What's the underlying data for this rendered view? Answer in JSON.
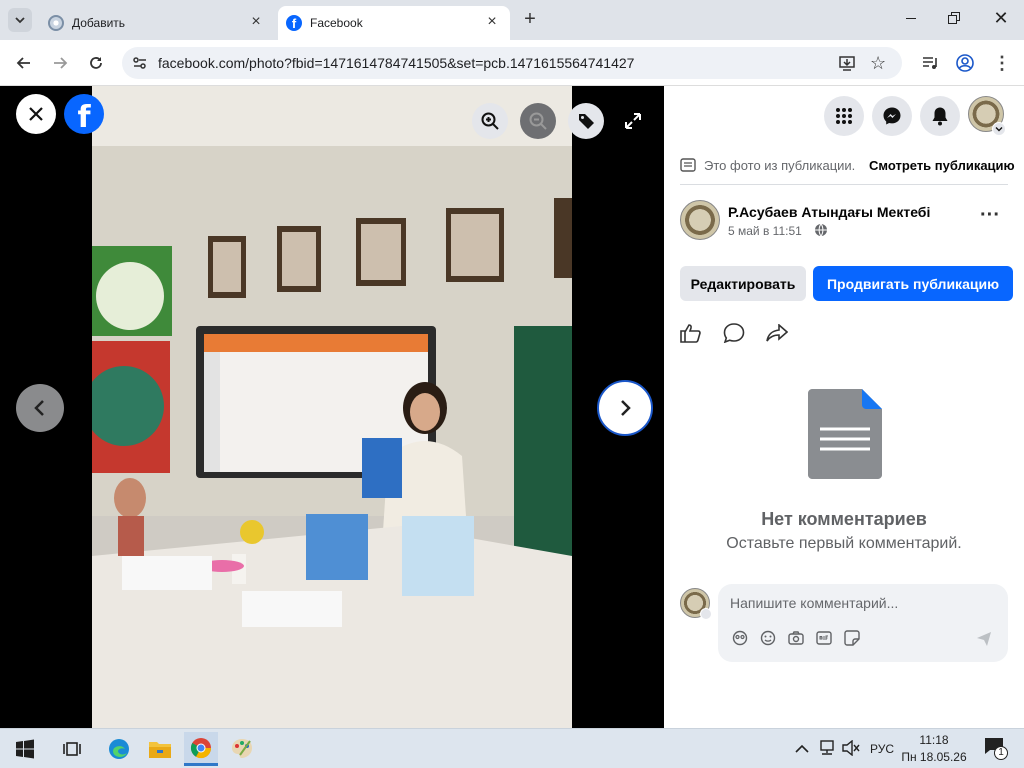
{
  "browser": {
    "tabs": [
      {
        "title": "Добавить",
        "active": false
      },
      {
        "title": "Facebook",
        "active": true
      }
    ],
    "url": "facebook.com/photo?fbid=1471614784741505&set=pcb.1471615564741427"
  },
  "post": {
    "from_post_text": "Это фото из публикации.",
    "view_post_link": "Смотреть публикацию",
    "author": "Р.Асубаев Атындағы Мектебі",
    "time": "5 май в 11:51",
    "edit_button": "Редактировать",
    "promote_button": "Продвигать публикацию",
    "no_comments_title": "Нет комментариев",
    "no_comments_sub": "Оставьте первый комментарий.",
    "comment_placeholder": "Напишите комментарий..."
  },
  "taskbar": {
    "language": "РУС",
    "time": "11:18",
    "date": "Пн 18.05.26",
    "notification_count": "1"
  },
  "colors": {
    "fb_blue": "#0866ff",
    "tabbar": "#dfe3e9",
    "panel_btn": "#e4e6eb"
  }
}
